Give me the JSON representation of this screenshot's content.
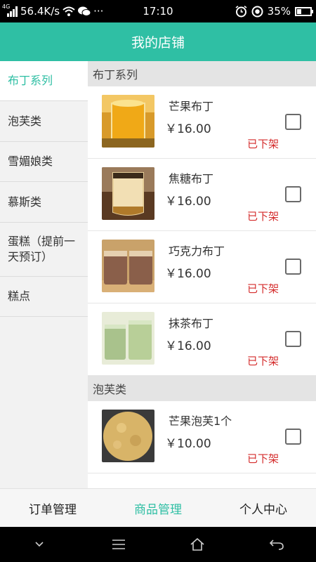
{
  "status_bar": {
    "network": "4G",
    "speed": "56.4K/s",
    "more": "···",
    "time": "17:10",
    "battery": "35%",
    "battery_level": 0.35
  },
  "header": {
    "title": "我的店铺"
  },
  "sidebar": {
    "items": [
      {
        "label": "布丁系列"
      },
      {
        "label": "泡芙类"
      },
      {
        "label": "雪媚娘类"
      },
      {
        "label": "慕斯类"
      },
      {
        "label": "蛋糕（提前一天预订）"
      },
      {
        "label": "糕点"
      }
    ]
  },
  "sections": [
    {
      "title": "布丁系列",
      "products": [
        {
          "name": "芒果布丁",
          "price": "￥16.00",
          "status": "已下架"
        },
        {
          "name": "焦糖布丁",
          "price": "￥16.00",
          "status": "已下架"
        },
        {
          "name": "巧克力布丁",
          "price": "￥16.00",
          "status": "已下架"
        },
        {
          "name": "抹茶布丁",
          "price": "￥16.00",
          "status": "已下架"
        }
      ]
    },
    {
      "title": "泡芙类",
      "products": [
        {
          "name": "芒果泡芙1个",
          "price": "￥10.00",
          "status": "已下架"
        }
      ]
    }
  ],
  "tabbar": {
    "orders": "订单管理",
    "products": "商品管理",
    "profile": "个人中心"
  },
  "colors": {
    "accent": "#2fbfa4",
    "status_red": "#d42b2b"
  },
  "icons": {
    "nav_down": "chevron-down-icon",
    "nav_menu": "menu-icon",
    "nav_home": "home-icon",
    "nav_back": "back-icon"
  }
}
